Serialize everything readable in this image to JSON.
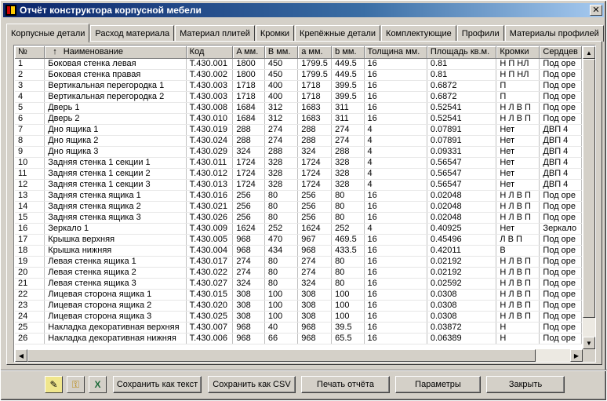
{
  "window": {
    "title": "Отчёт конструктора корпусной мебели",
    "close_glyph": "✕"
  },
  "tabs": [
    {
      "label": "Корпусные детали",
      "active": true
    },
    {
      "label": "Расход материала"
    },
    {
      "label": "Материал плитей"
    },
    {
      "label": "Кромки"
    },
    {
      "label": "Крепёжные детали"
    },
    {
      "label": "Комплектующие"
    },
    {
      "label": "Профили"
    },
    {
      "label": "Материалы профилей"
    }
  ],
  "table": {
    "sort_indicator": "↑",
    "columns": [
      "№",
      "Наименование",
      "Код",
      "A мм.",
      "B мм.",
      "a мм.",
      "b мм.",
      "Толщина мм.",
      "Площадь кв.м.",
      "Кромки",
      "Сердцев"
    ],
    "rows": [
      [
        "1",
        "Боковая стенка левая",
        "T.430.001",
        "1800",
        "450",
        "1799.5",
        "449.5",
        "16",
        "0.81",
        "Н П НЛ",
        "Под оре"
      ],
      [
        "2",
        "Боковая стенка правая",
        "T.430.002",
        "1800",
        "450",
        "1799.5",
        "449.5",
        "16",
        "0.81",
        "Н П НЛ",
        "Под оре"
      ],
      [
        "3",
        "Вертикальная перегородка 1",
        "T.430.003",
        "1718",
        "400",
        "1718",
        "399.5",
        "16",
        "0.6872",
        "П",
        "Под оре"
      ],
      [
        "4",
        "Вертикальная перегородка 2",
        "T.430.003",
        "1718",
        "400",
        "1718",
        "399.5",
        "16",
        "0.6872",
        "П",
        "Под оре"
      ],
      [
        "5",
        "Дверь 1",
        "T.430.008",
        "1684",
        "312",
        "1683",
        "311",
        "16",
        "0.52541",
        "Н Л В П",
        "Под оре"
      ],
      [
        "6",
        "Дверь 2",
        "T.430.010",
        "1684",
        "312",
        "1683",
        "311",
        "16",
        "0.52541",
        "Н Л В П",
        "Под оре"
      ],
      [
        "7",
        "Дно ящика 1",
        "T.430.019",
        "288",
        "274",
        "288",
        "274",
        "4",
        "0.07891",
        "Нет",
        "ДВП 4"
      ],
      [
        "8",
        "Дно ящика 2",
        "T.430.024",
        "288",
        "274",
        "288",
        "274",
        "4",
        "0.07891",
        "Нет",
        "ДВП 4"
      ],
      [
        "9",
        "Дно ящика 3",
        "T.430.029",
        "324",
        "288",
        "324",
        "288",
        "4",
        "0.09331",
        "Нет",
        "ДВП 4"
      ],
      [
        "10",
        "Задняя стенка 1 секции 1",
        "T.430.011",
        "1724",
        "328",
        "1724",
        "328",
        "4",
        "0.56547",
        "Нет",
        "ДВП 4"
      ],
      [
        "11",
        "Задняя стенка 1 секции 2",
        "T.430.012",
        "1724",
        "328",
        "1724",
        "328",
        "4",
        "0.56547",
        "Нет",
        "ДВП 4"
      ],
      [
        "12",
        "Задняя стенка 1 секции 3",
        "T.430.013",
        "1724",
        "328",
        "1724",
        "328",
        "4",
        "0.56547",
        "Нет",
        "ДВП 4"
      ],
      [
        "13",
        "Задняя стенка ящика 1",
        "T.430.016",
        "256",
        "80",
        "256",
        "80",
        "16",
        "0.02048",
        "Н Л В П",
        "Под оре"
      ],
      [
        "14",
        "Задняя стенка ящика 2",
        "T.430.021",
        "256",
        "80",
        "256",
        "80",
        "16",
        "0.02048",
        "Н Л В П",
        "Под оре"
      ],
      [
        "15",
        "Задняя стенка ящика 3",
        "T.430.026",
        "256",
        "80",
        "256",
        "80",
        "16",
        "0.02048",
        "Н Л В П",
        "Под оре"
      ],
      [
        "16",
        "Зеркало 1",
        "T.430.009",
        "1624",
        "252",
        "1624",
        "252",
        "4",
        "0.40925",
        "Нет",
        "Зеркало"
      ],
      [
        "17",
        "Крышка верхняя",
        "T.430.005",
        "968",
        "470",
        "967",
        "469.5",
        "16",
        "0.45496",
        "Л В П",
        "Под оре"
      ],
      [
        "18",
        "Крышка нижняя",
        "T.430.004",
        "968",
        "434",
        "968",
        "433.5",
        "16",
        "0.42011",
        "В",
        "Под оре"
      ],
      [
        "19",
        "Левая стенка ящика 1",
        "T.430.017",
        "274",
        "80",
        "274",
        "80",
        "16",
        "0.02192",
        "Н Л В П",
        "Под оре"
      ],
      [
        "20",
        "Левая стенка ящика 2",
        "T.430.022",
        "274",
        "80",
        "274",
        "80",
        "16",
        "0.02192",
        "Н Л В П",
        "Под оре"
      ],
      [
        "21",
        "Левая стенка ящика 3",
        "T.430.027",
        "324",
        "80",
        "324",
        "80",
        "16",
        "0.02592",
        "Н Л В П",
        "Под оре"
      ],
      [
        "22",
        "Лицевая сторона ящика 1",
        "T.430.015",
        "308",
        "100",
        "308",
        "100",
        "16",
        "0.0308",
        "Н Л В П",
        "Под оре"
      ],
      [
        "23",
        "Лицевая сторона ящика 2",
        "T.430.020",
        "308",
        "100",
        "308",
        "100",
        "16",
        "0.0308",
        "Н Л В П",
        "Под оре"
      ],
      [
        "24",
        "Лицевая сторона ящика 3",
        "T.430.025",
        "308",
        "100",
        "308",
        "100",
        "16",
        "0.0308",
        "Н Л В П",
        "Под оре"
      ],
      [
        "25",
        "Накладка декоративная верхняя",
        "T.430.007",
        "968",
        "40",
        "968",
        "39.5",
        "16",
        "0.03872",
        "Н",
        "Под оре"
      ],
      [
        "26",
        "Накладка декоративная нижняя",
        "T.430.006",
        "968",
        "66",
        "968",
        "65.5",
        "16",
        "0.06389",
        "Н",
        "Под оре"
      ]
    ]
  },
  "scrollbars": {
    "up": "▲",
    "down": "▼",
    "left": "◀",
    "right": "▶"
  },
  "toolbar": {
    "icons": [
      "edit-icon",
      "key-icon",
      "excel-icon"
    ],
    "icon_glyphs": [
      "✎",
      "⚿",
      "X"
    ],
    "save_text": "Сохранить как текст",
    "save_csv": "Сохранить как CSV",
    "print": "Печать отчёта",
    "params": "Параметры",
    "close": "Закрыть"
  },
  "colors": {
    "title_start": "#0a246a",
    "title_end": "#a6caf0",
    "face": "#d4d0c8"
  }
}
